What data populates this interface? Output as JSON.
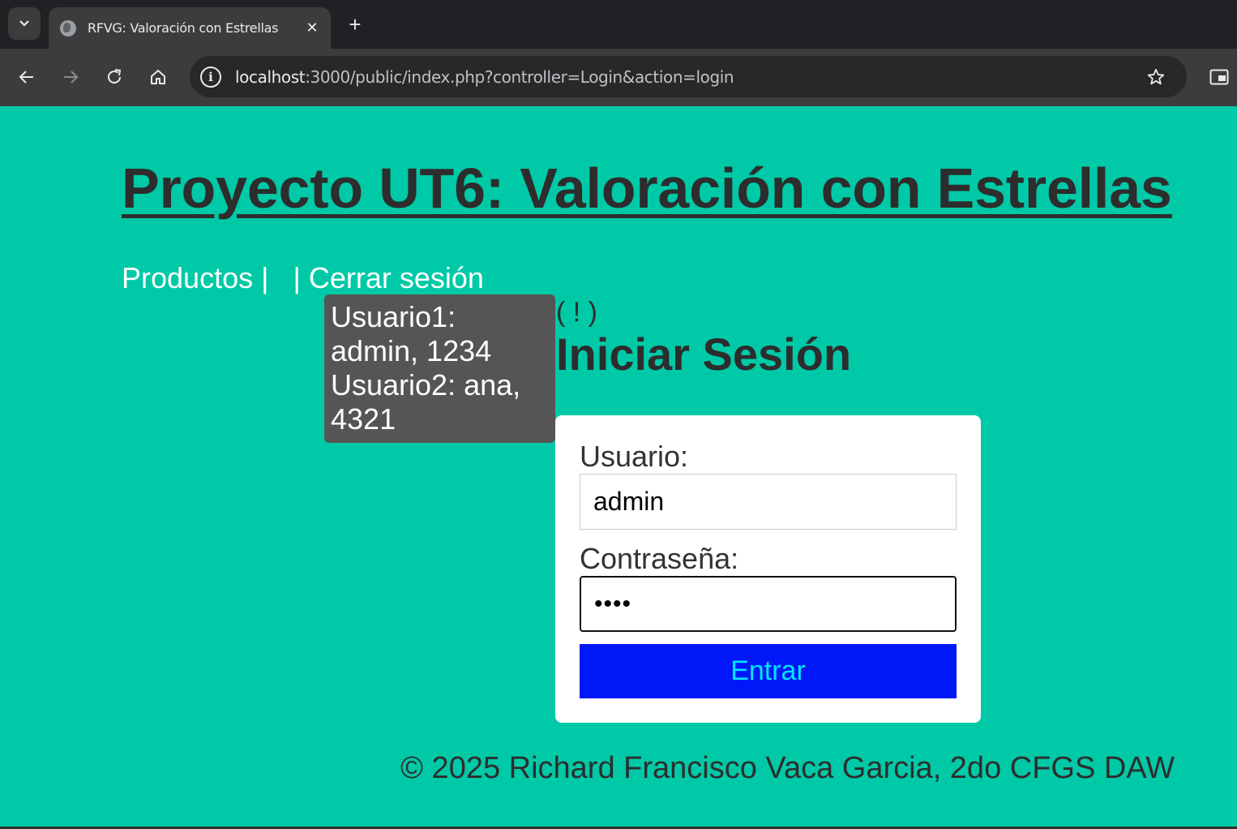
{
  "browser": {
    "tab_title": "RFVG: Valoración con Estrellas",
    "tab_close": "✕",
    "new_tab": "+",
    "url_host": "localhost",
    "url_rest": ":3000/public/index.php?controller=Login&action=login",
    "site_info_icon": "info-icon",
    "back_icon": "arrow-left-icon",
    "forward_icon": "arrow-right-icon",
    "reload_icon": "reload-icon",
    "home_icon": "home-icon",
    "bookmark_icon": "star-icon"
  },
  "page": {
    "title": "Proyecto UT6: Valoración con Estrellas",
    "nav": {
      "products": "Productos",
      "sep1": " | ",
      "sep2": " | ",
      "logout": "Cerrar sesión"
    },
    "tooltip": {
      "line1": "Usuario1: admin, 1234",
      "line2": "Usuario2: ana, 4321"
    },
    "tooltip_trigger": "( ! )",
    "heading": "Iniciar Sesión",
    "form": {
      "username_label": "Usuario:",
      "username_value": "admin",
      "password_label": "Contraseña:",
      "password_value": "••••",
      "submit_label": "Entrar"
    },
    "footer": "© 2025 Richard Francisco Vaca Garcia, 2do CFGS DAW"
  },
  "colors": {
    "page_background": "#00c9a7",
    "button_background": "#0018f8",
    "button_text": "#00e5ff",
    "tooltip_background": "#555555"
  }
}
